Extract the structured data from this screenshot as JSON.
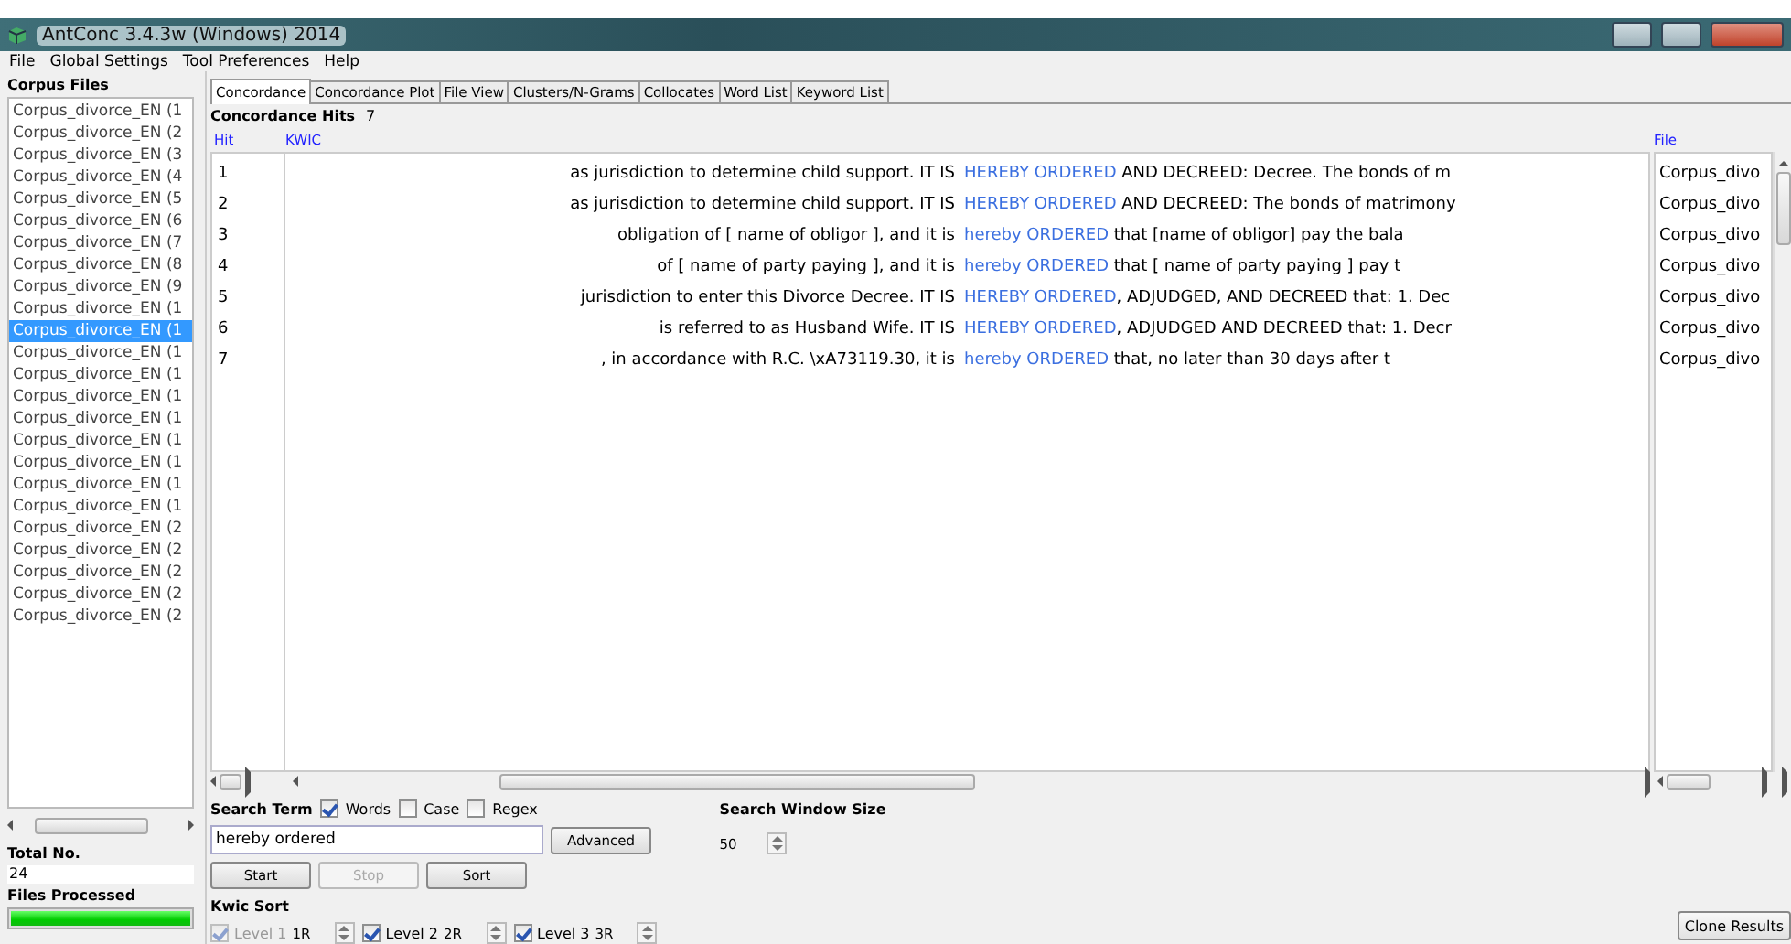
{
  "window": {
    "title": "AntConc 3.4.3w (Windows) 2014"
  },
  "menu": [
    "File",
    "Global Settings",
    "Tool Preferences",
    "Help"
  ],
  "corpus_files": {
    "heading": "Corpus Files",
    "items": [
      {
        "name": "Corpus_divorce_EN (1",
        "selected": false
      },
      {
        "name": "Corpus_divorce_EN (2",
        "selected": false
      },
      {
        "name": "Corpus_divorce_EN (3",
        "selected": false
      },
      {
        "name": "Corpus_divorce_EN (4",
        "selected": false
      },
      {
        "name": "Corpus_divorce_EN (5",
        "selected": false
      },
      {
        "name": "Corpus_divorce_EN (6",
        "selected": false
      },
      {
        "name": "Corpus_divorce_EN (7",
        "selected": false
      },
      {
        "name": "Corpus_divorce_EN (8",
        "selected": false
      },
      {
        "name": "Corpus_divorce_EN (9",
        "selected": false
      },
      {
        "name": "Corpus_divorce_EN (1",
        "selected": false
      },
      {
        "name": "Corpus_divorce_EN (1",
        "selected": true
      },
      {
        "name": "Corpus_divorce_EN (1",
        "selected": false
      },
      {
        "name": "Corpus_divorce_EN (1",
        "selected": false
      },
      {
        "name": "Corpus_divorce_EN (1",
        "selected": false
      },
      {
        "name": "Corpus_divorce_EN (1",
        "selected": false
      },
      {
        "name": "Corpus_divorce_EN (1",
        "selected": false
      },
      {
        "name": "Corpus_divorce_EN (1",
        "selected": false
      },
      {
        "name": "Corpus_divorce_EN (1",
        "selected": false
      },
      {
        "name": "Corpus_divorce_EN (1",
        "selected": false
      },
      {
        "name": "Corpus_divorce_EN (2",
        "selected": false
      },
      {
        "name": "Corpus_divorce_EN (2",
        "selected": false
      },
      {
        "name": "Corpus_divorce_EN (2",
        "selected": false
      },
      {
        "name": "Corpus_divorce_EN (2",
        "selected": false
      },
      {
        "name": "Corpus_divorce_EN (2",
        "selected": false
      }
    ]
  },
  "total": {
    "label": "Total No.",
    "value": "24"
  },
  "files_processed": {
    "label": "Files Processed",
    "level": 1
  },
  "tabs": [
    {
      "label": "Concordance",
      "selected": true
    },
    {
      "label": "Concordance Plot",
      "selected": false
    },
    {
      "label": "File View",
      "selected": false
    },
    {
      "label": "Clusters/N-Grams",
      "selected": false
    },
    {
      "label": "Collocates",
      "selected": false
    },
    {
      "label": "Word List",
      "selected": false
    },
    {
      "label": "Keyword List",
      "selected": false
    }
  ],
  "concordance": {
    "hits_label": "Concordance Hits",
    "hits": "7",
    "columns": {
      "hit": "Hit",
      "kwic": "KWIC",
      "file": "File"
    },
    "rows": [
      {
        "hit": "1",
        "left": "as jurisdiction to determine child support. IT IS",
        "keyword": "HEREBY ORDERED",
        "right": " AND DECREED: Decree. The bonds of m",
        "file": "Corpus_divo"
      },
      {
        "hit": "2",
        "left": "as jurisdiction to determine child support. IT IS",
        "keyword": "HEREBY ORDERED",
        "right": " AND DECREED: The bonds of matrimony",
        "file": "Corpus_divo"
      },
      {
        "hit": "3",
        "left": "obligation of [ name of obligor ], and it is",
        "keyword": "hereby ORDERED",
        "right": " that [name of obligor] pay the bala",
        "file": "Corpus_divo"
      },
      {
        "hit": "4",
        "left": "of [ name of party paying ], and it is",
        "keyword": "hereby ORDERED",
        "right": " that [ name of party paying ] pay t",
        "file": "Corpus_divo"
      },
      {
        "hit": "5",
        "left": "jurisdiction to enter this Divorce Decree. IT IS",
        "keyword": "HEREBY ORDERED",
        "right": ", ADJUDGED, AND DECREED that: 1. Dec",
        "file": "Corpus_divo"
      },
      {
        "hit": "6",
        "left": "is referred to as Husband Wife. IT IS",
        "keyword": "HEREBY ORDERED",
        "right": ", ADJUDGED AND DECREED that: 1. Decr",
        "file": "Corpus_divo"
      },
      {
        "hit": "7",
        "left": ", in accordance with R.C. \\xA73119.30, it is",
        "keyword": "hereby ORDERED",
        "right": " that, no later than 30 days after t",
        "file": "Corpus_divo"
      }
    ]
  },
  "search": {
    "label": "Search Term",
    "options": [
      {
        "label": "Words",
        "checked": true
      },
      {
        "label": "Case",
        "checked": false
      },
      {
        "label": "Regex",
        "checked": false
      }
    ],
    "value": "hereby ordered",
    "advanced": "Advanced",
    "window_size_label": "Search Window Size",
    "window_size": "50",
    "buttons": [
      {
        "label": "Start",
        "disabled": false
      },
      {
        "label": "Stop",
        "disabled": true
      },
      {
        "label": "Sort",
        "disabled": false
      }
    ]
  },
  "kwic_sort": {
    "label": "Kwic Sort",
    "levels": [
      {
        "label": "Level 1",
        "value": "1R",
        "checked": true,
        "disabled": true
      },
      {
        "label": "Level 2",
        "value": "2R",
        "checked": true,
        "disabled": false
      },
      {
        "label": "Level 3",
        "value": "3R",
        "checked": true,
        "disabled": false
      }
    ]
  },
  "clone_button": "Clone Results"
}
